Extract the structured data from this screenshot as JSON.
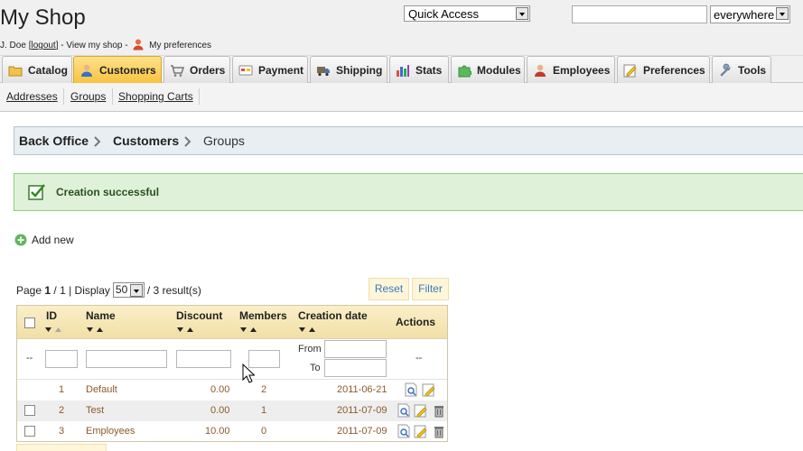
{
  "header": {
    "shop_title": "My Shop",
    "user_name": "J. Doe",
    "bracket_open": "[",
    "logout_label": "logout",
    "bracket_close": "]",
    "view_shop_label": "- View my shop -",
    "preferences_label": "My preferences",
    "quick_access_value": "Quick Access",
    "search_value": "",
    "search_scope_value": "everywhere"
  },
  "tabs": [
    {
      "label": "Catalog",
      "icon": "catalog-icon"
    },
    {
      "label": "Customers",
      "icon": "customers-icon",
      "active": true
    },
    {
      "label": "Orders",
      "icon": "orders-icon"
    },
    {
      "label": "Payment",
      "icon": "payment-icon"
    },
    {
      "label": "Shipping",
      "icon": "shipping-icon"
    },
    {
      "label": "Stats",
      "icon": "stats-icon"
    },
    {
      "label": "Modules",
      "icon": "modules-icon"
    },
    {
      "label": "Employees",
      "icon": "employees-icon"
    },
    {
      "label": "Preferences",
      "icon": "preferences-icon"
    },
    {
      "label": "Tools",
      "icon": "tools-icon"
    }
  ],
  "subtabs": [
    "Addresses",
    "Groups",
    "Shopping Carts"
  ],
  "breadcrumb": [
    "Back Office",
    "Customers",
    "Groups"
  ],
  "alert": {
    "message": "Creation successful",
    "color": "#dff2d9"
  },
  "add_new_label": "Add new",
  "pagination": {
    "page_label": "Page",
    "page": "1",
    "pages": "/ 1 | Display",
    "per_page": "50",
    "results": "/ 3 result(s)"
  },
  "buttons": {
    "reset": "Reset",
    "filter": "Filter"
  },
  "table": {
    "columns": {
      "id": "ID",
      "name": "Name",
      "discount": "Discount",
      "members": "Members",
      "creation_date": "Creation date",
      "actions": "Actions"
    },
    "filter": {
      "placeholder_dash": "--",
      "from_label": "From",
      "to_label": "To",
      "actions_dash": "--"
    },
    "rows": [
      {
        "id": "1",
        "name": "Default",
        "discount": "0.00",
        "members": "2",
        "date": "2011-06-21",
        "actions": [
          "view-icon",
          "edit-icon"
        ]
      },
      {
        "id": "2",
        "name": "Test",
        "discount": "0.00",
        "members": "1",
        "date": "2011-07-09",
        "actions": [
          "view-icon",
          "edit-icon",
          "delete-icon"
        ]
      },
      {
        "id": "3",
        "name": "Employees",
        "discount": "10.00",
        "members": "0",
        "date": "2011-07-09",
        "actions": [
          "view-icon",
          "edit-icon",
          "delete-icon"
        ]
      }
    ]
  },
  "colors": {
    "active_tab": "#f7c441",
    "header_bg": "#f0f0f0",
    "table_head": "#f1dfa6",
    "link_brown": "#8b5a2b"
  }
}
